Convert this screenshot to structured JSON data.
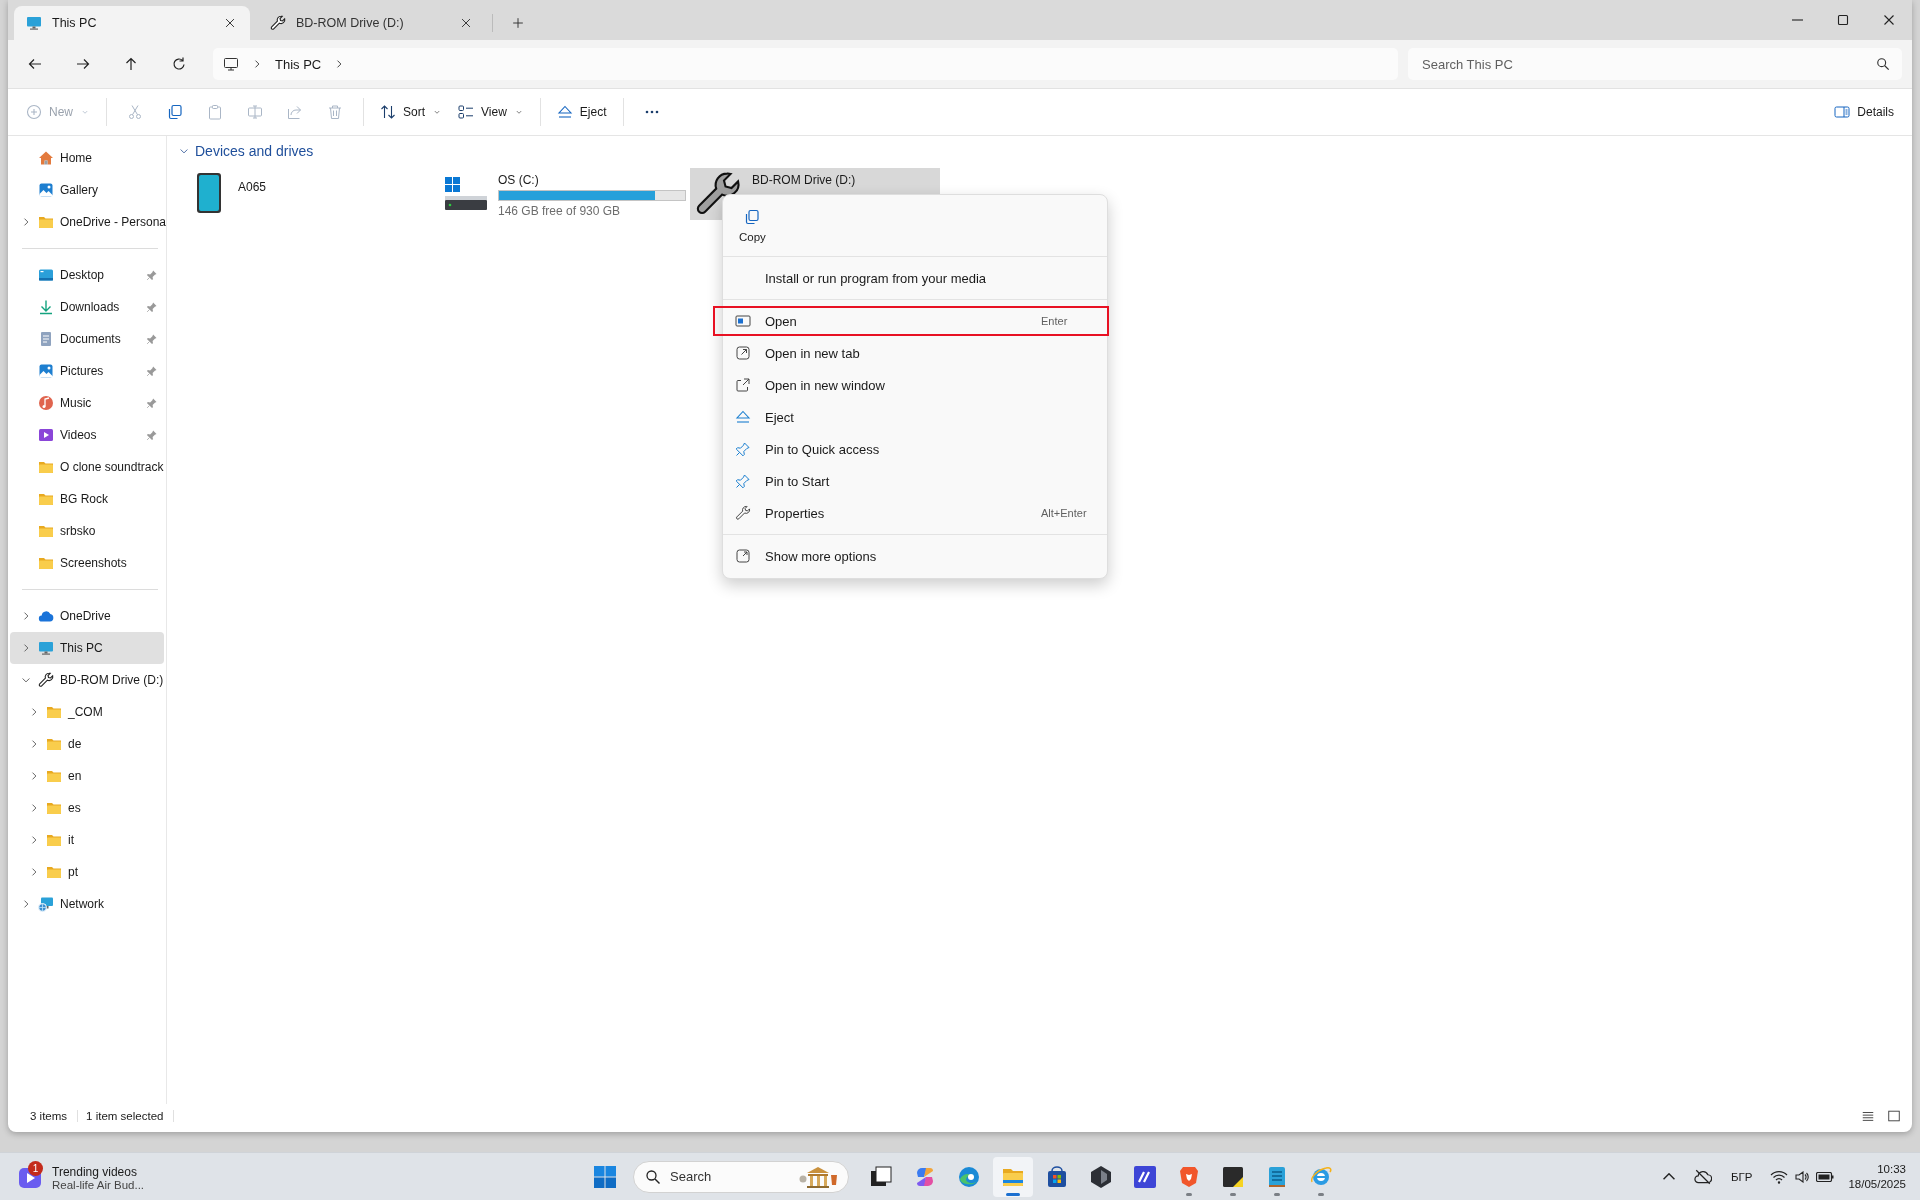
{
  "window": {
    "tabs": [
      {
        "label": "This PC",
        "kind": "pc",
        "selected": true
      },
      {
        "label": "BD-ROM Drive (D:)",
        "kind": "drive",
        "selected": false
      }
    ]
  },
  "address_bar": {
    "breadcrumb": [
      "This PC"
    ],
    "search": {
      "placeholder": "Search This PC"
    }
  },
  "toolbar": {
    "groups": [
      [
        {
          "kind": "new",
          "label": "New",
          "menu": true,
          "disabled": true
        }
      ],
      [
        {
          "kind": "cut",
          "menu": false,
          "disabled": true
        },
        {
          "kind": "copy",
          "menu": false,
          "disabled": false
        },
        {
          "kind": "paste",
          "menu": false,
          "disabled": true
        },
        {
          "kind": "rename",
          "menu": false,
          "disabled": true
        },
        {
          "kind": "share",
          "menu": false,
          "disabled": true
        },
        {
          "kind": "delete",
          "menu": false,
          "disabled": true
        }
      ],
      [
        {
          "kind": "sort",
          "label": "Sort",
          "menu": true,
          "disabled": false
        },
        {
          "kind": "view",
          "label": "View",
          "menu": true,
          "disabled": false
        }
      ],
      [
        {
          "kind": "eject",
          "label": "Eject",
          "menu": false,
          "disabled": false
        }
      ],
      [
        {
          "kind": "more",
          "menu": false,
          "disabled": false
        }
      ]
    ],
    "details": {
      "label": "Details"
    }
  },
  "sidebar": {
    "groups": [
      [
        {
          "label": "Home",
          "kind": "home",
          "expandable": false,
          "pinned": false,
          "selected": false
        },
        {
          "label": "Gallery",
          "kind": "gallery",
          "expandable": false,
          "pinned": false,
          "selected": false
        },
        {
          "label": "OneDrive - Persona",
          "kind": "folder",
          "expandable": true,
          "expanded": false,
          "pinned": false,
          "selected": false
        }
      ],
      [
        {
          "label": "Desktop",
          "kind": "desktop",
          "expandable": false,
          "pinned": true,
          "selected": false
        },
        {
          "label": "Downloads",
          "kind": "downloads",
          "expandable": false,
          "pinned": true,
          "selected": false
        },
        {
          "label": "Documents",
          "kind": "documents",
          "expandable": false,
          "pinned": true,
          "selected": false
        },
        {
          "label": "Pictures",
          "kind": "pictures",
          "expandable": false,
          "pinned": true,
          "selected": false
        },
        {
          "label": "Music",
          "kind": "music",
          "expandable": false,
          "pinned": true,
          "selected": false
        },
        {
          "label": "Videos",
          "kind": "videos",
          "expandable": false,
          "pinned": true,
          "selected": false
        },
        {
          "label": "O clone soundtrack",
          "kind": "folder",
          "expandable": false,
          "pinned": false,
          "selected": false
        },
        {
          "label": "BG Rock",
          "kind": "folder",
          "expandable": false,
          "pinned": false,
          "selected": false
        },
        {
          "label": "srbsko",
          "kind": "folder",
          "expandable": false,
          "pinned": false,
          "selected": false
        },
        {
          "label": "Screenshots",
          "kind": "folder",
          "expandable": false,
          "pinned": false,
          "selected": false
        }
      ],
      [
        {
          "label": "OneDrive",
          "kind": "cloud",
          "expandable": true,
          "expanded": false,
          "pinned": false,
          "selected": false
        },
        {
          "label": "This PC",
          "kind": "pc",
          "expandable": true,
          "expanded": false,
          "pinned": false,
          "selected": true
        },
        {
          "label": "BD-ROM Drive (D:)",
          "kind": "drive",
          "expandable": true,
          "expanded": true,
          "pinned": false,
          "selected": false,
          "children": [
            {
              "label": "_COM",
              "kind": "folder",
              "expandable": true,
              "expanded": false,
              "pinned": false,
              "selected": false
            },
            {
              "label": "de",
              "kind": "folder",
              "expandable": true,
              "expanded": false,
              "pinned": false,
              "selected": false
            },
            {
              "label": "en",
              "kind": "folder",
              "expandable": true,
              "expanded": false,
              "pinned": false,
              "selected": false
            },
            {
              "label": "es",
              "kind": "folder",
              "expandable": true,
              "expanded": false,
              "pinned": false,
              "selected": false
            },
            {
              "label": "it",
              "kind": "folder",
              "expandable": true,
              "expanded": false,
              "pinned": false,
              "selected": false
            },
            {
              "label": "pt",
              "kind": "folder",
              "expandable": true,
              "expanded": false,
              "pinned": false,
              "selected": false
            }
          ]
        },
        {
          "label": "Network",
          "kind": "network",
          "expandable": true,
          "expanded": false,
          "pinned": false,
          "selected": false
        }
      ]
    ]
  },
  "content": {
    "section": {
      "title": "Devices and drives",
      "expanded": true
    },
    "drives": [
      {
        "name": "A065",
        "kind": "phone",
        "selected": false
      },
      {
        "name": "OS (C:)",
        "kind": "disk",
        "selected": false,
        "level": 0.84,
        "free": "146 GB free of 930 GB"
      },
      {
        "name": "BD-ROM Drive (D:)",
        "kind": "disc",
        "selected": true
      }
    ]
  },
  "context_menu": {
    "quick_actions": [
      {
        "kind": "copy",
        "label": "Copy"
      }
    ],
    "groups": [
      [
        {
          "kind": "install",
          "label": "Install or run program from your media",
          "highlighted": false
        }
      ],
      [
        {
          "kind": "open",
          "label": "Open",
          "shortcut": "Enter",
          "highlighted": true
        },
        {
          "kind": "open_tab",
          "label": "Open in new tab",
          "highlighted": false
        },
        {
          "kind": "open_window",
          "label": "Open in new window",
          "highlighted": false
        },
        {
          "kind": "eject",
          "label": "Eject",
          "highlighted": false
        },
        {
          "kind": "pin_quick",
          "label": "Pin to Quick access",
          "highlighted": false
        },
        {
          "kind": "pin_start",
          "label": "Pin to Start",
          "highlighted": false
        },
        {
          "kind": "properties",
          "label": "Properties",
          "shortcut": "Alt+Enter",
          "highlighted": false
        }
      ],
      [
        {
          "kind": "more_options",
          "label": "Show more options",
          "highlighted": false
        }
      ]
    ]
  },
  "status_bar": {
    "items": [
      "3 items",
      "1 item selected"
    ]
  },
  "taskbar": {
    "widget": {
      "title": "Trending videos",
      "subtitle": "Real-life Air Bud...",
      "badge": "1"
    },
    "search": {
      "placeholder": "Search"
    },
    "apps": [
      {
        "kind": "task_view",
        "running": false,
        "selected": false
      },
      {
        "kind": "swirl",
        "running": false,
        "selected": false
      },
      {
        "kind": "wave",
        "running": false,
        "selected": false
      },
      {
        "kind": "files",
        "running": true,
        "selected": true
      },
      {
        "kind": "bag",
        "running": false,
        "selected": false
      },
      {
        "kind": "hexagon",
        "running": false,
        "selected": false
      },
      {
        "kind": "slashes",
        "running": false,
        "selected": false
      },
      {
        "kind": "shield",
        "running": true,
        "selected": false
      },
      {
        "kind": "note",
        "running": true,
        "selected": false
      },
      {
        "kind": "notepad",
        "running": true,
        "selected": false
      },
      {
        "kind": "globe",
        "running": true,
        "selected": false
      }
    ],
    "tray": {
      "language": "БГР",
      "time": "10:33",
      "date": "18/05/2025"
    }
  }
}
